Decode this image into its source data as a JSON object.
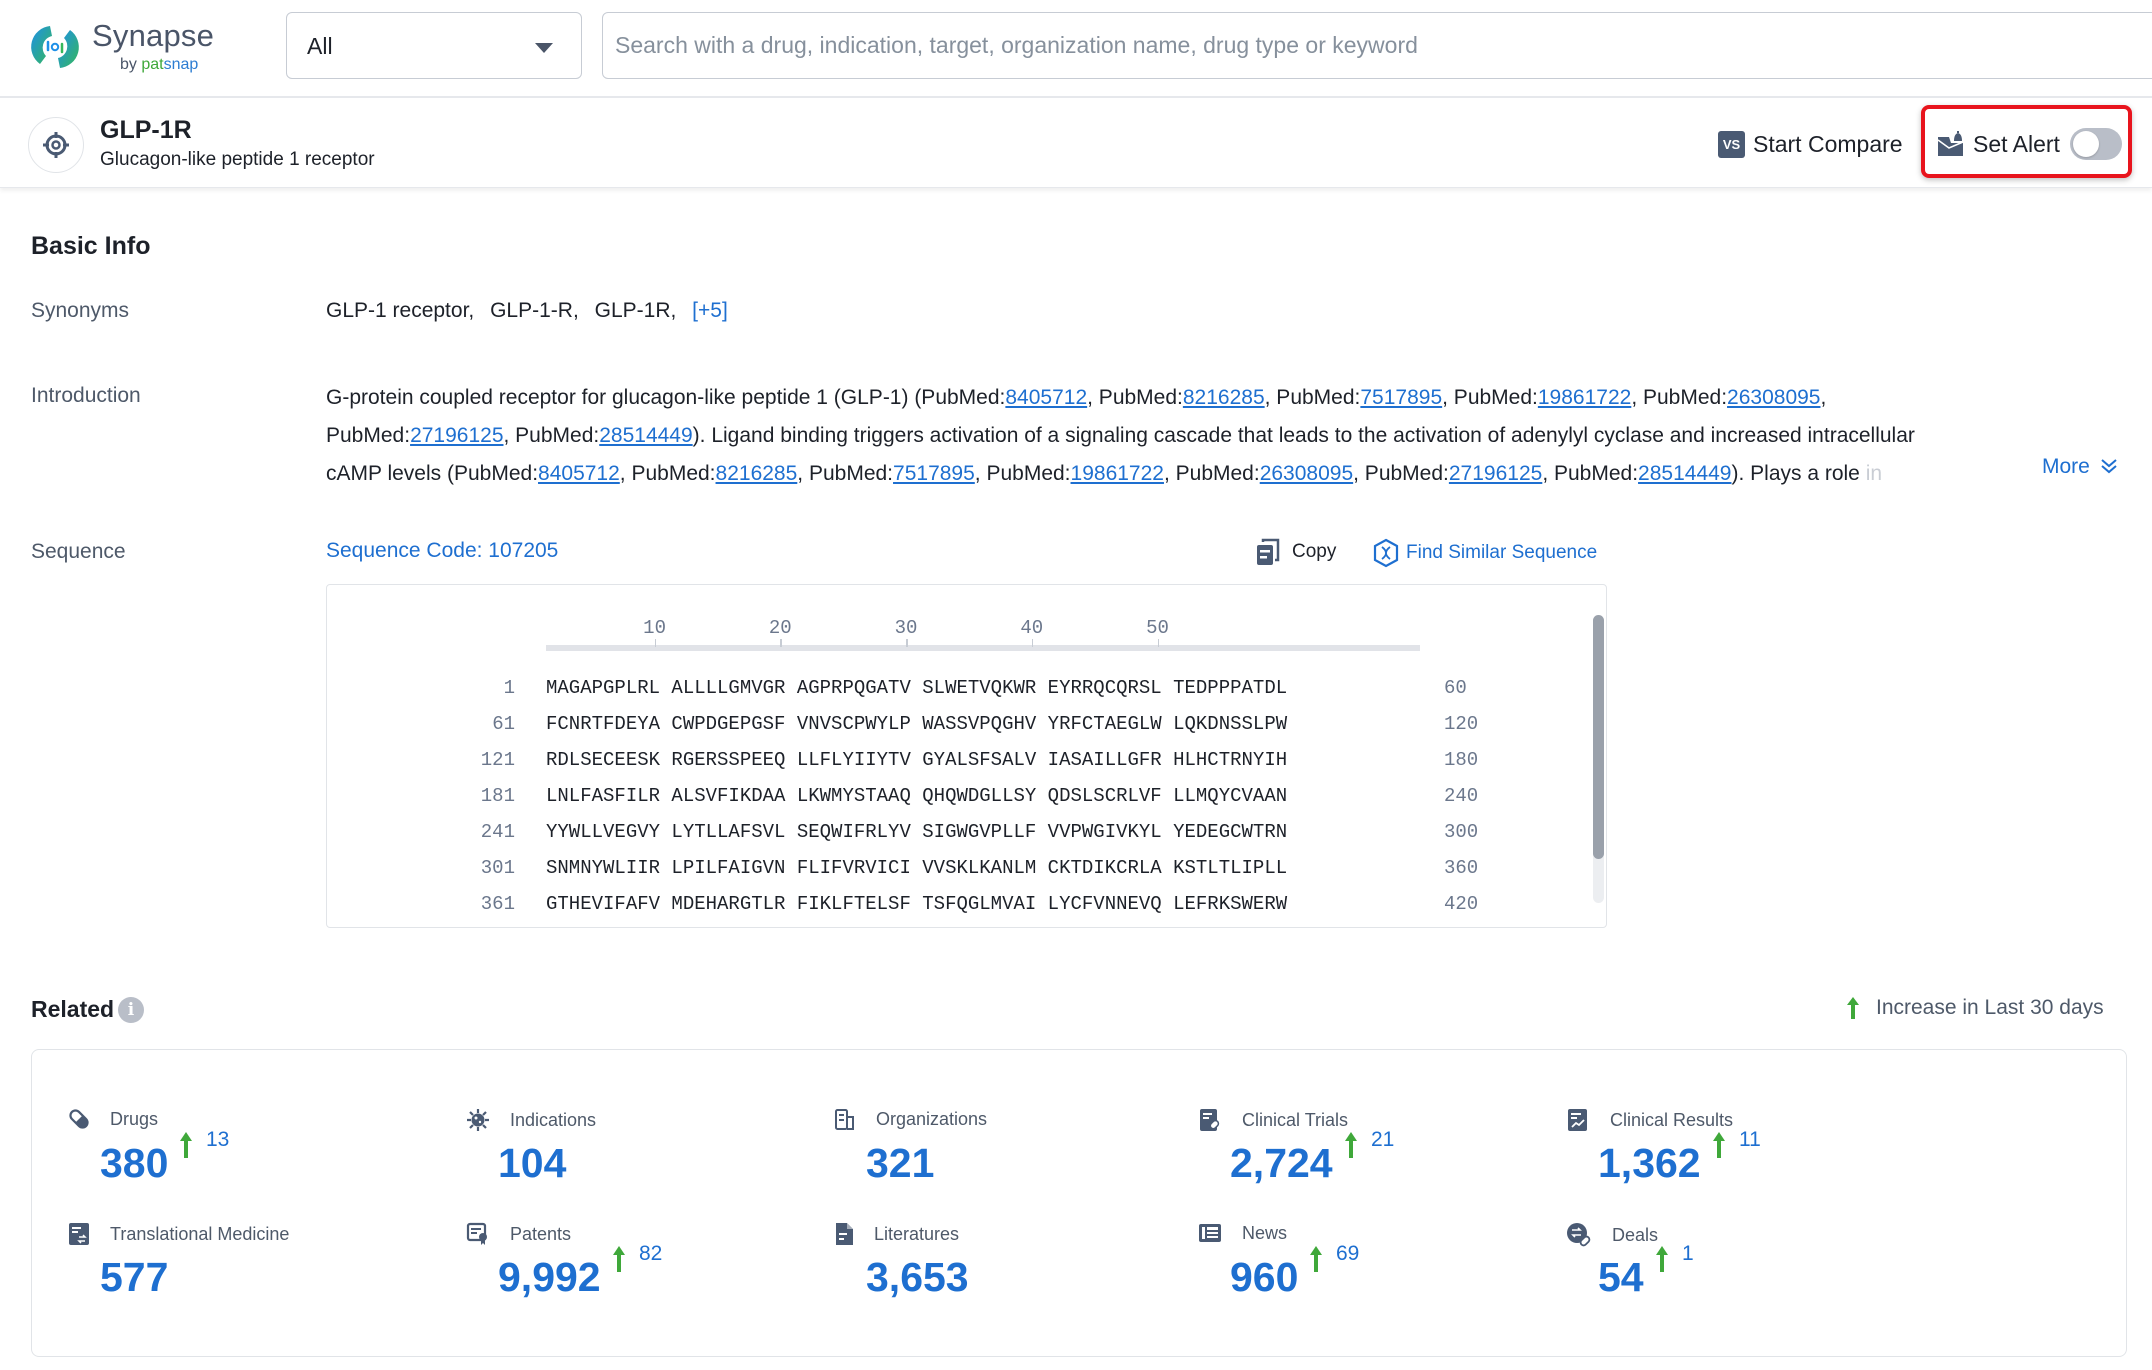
{
  "header": {
    "logo_name": "Synapse",
    "logo_by": "by",
    "logo_pat": "pat",
    "logo_snap": "snap",
    "scope_select_value": "All",
    "search_placeholder": "Search with a drug, indication, target, organization name, drug type or keyword",
    "search_value": ""
  },
  "entity": {
    "icon": "target-icon",
    "title": "GLP-1R",
    "subtitle": "Glucagon-like peptide 1 receptor",
    "compare_icon_text": "VS",
    "compare_label": "Start Compare",
    "alert_label": "Set Alert",
    "alert_enabled": false
  },
  "basic_info": {
    "title": "Basic Info",
    "synonyms_label": "Synonyms",
    "synonyms": [
      "GLP-1 receptor,",
      "GLP-1-R,",
      "GLP-1R,"
    ],
    "synonyms_more": "[+5]",
    "introduction_label": "Introduction",
    "introduction_lines": [
      [
        {
          "t": "G-protein coupled receptor for glucagon-like peptide 1 (GLP-1) (PubMed:"
        },
        {
          "link": "8405712"
        },
        {
          "t": ", PubMed:"
        },
        {
          "link": "8216285"
        },
        {
          "t": ", PubMed:"
        },
        {
          "link": "7517895"
        },
        {
          "t": ", PubMed:"
        },
        {
          "link": "19861722"
        },
        {
          "t": ", PubMed:"
        },
        {
          "link": "26308095"
        },
        {
          "t": ","
        }
      ],
      [
        {
          "t": "PubMed:"
        },
        {
          "link": "27196125"
        },
        {
          "t": ", PubMed:"
        },
        {
          "link": "28514449"
        },
        {
          "t": "). Ligand binding triggers activation of a signaling cascade that leads to the activation of adenylyl cyclase and increased intracellular"
        }
      ],
      [
        {
          "t": "cAMP levels (PubMed:"
        },
        {
          "link": "8405712"
        },
        {
          "t": ", PubMed:"
        },
        {
          "link": "8216285"
        },
        {
          "t": ", PubMed:"
        },
        {
          "link": "7517895"
        },
        {
          "t": ", PubMed:"
        },
        {
          "link": "19861722"
        },
        {
          "t": ", PubMed:"
        },
        {
          "link": "26308095"
        },
        {
          "t": ", PubMed:"
        },
        {
          "link": "27196125"
        },
        {
          "t": ", PubMed:"
        },
        {
          "link": "28514449"
        },
        {
          "t": "). Plays a role "
        },
        {
          "fade": "in"
        }
      ]
    ],
    "more_label": "More",
    "sequence_label": "Sequence",
    "sequence_code": "Sequence Code: 107205",
    "copy_label": "Copy",
    "find_similar_label": "Find Similar Sequence",
    "ruler_ticks": [
      "10",
      "20",
      "30",
      "40",
      "50"
    ],
    "sequence_rows": [
      {
        "start": "1",
        "residues": "MAGAPGPLRL ALLLLGMVGR AGPRPQGATV SLWETVQKWR EYRRQCQRSL TEDPPPATDL",
        "end": "60"
      },
      {
        "start": "61",
        "residues": "FCNRTFDEYA CWPDGEPGSF VNVSCPWYLP WASSVPQGHV YRFCTAEGLW LQKDNSSLPW",
        "end": "120"
      },
      {
        "start": "121",
        "residues": "RDLSECEESK RGERSSPEEQ LLFLYIIYTV GYALSFSALV IASAILLGFR HLHCTRNYIH",
        "end": "180"
      },
      {
        "start": "181",
        "residues": "LNLFASFILR ALSVFIKDAA LKWMYSTAAQ QHQWDGLLSY QDSLSCRLVF LLMQYCVAAN",
        "end": "240"
      },
      {
        "start": "241",
        "residues": "YYWLLVEGVY LYTLLAFSVL SEQWIFRLYV SIGWGVPLLF VVPWGIVKYL YEDEGCWTRN",
        "end": "300"
      },
      {
        "start": "301",
        "residues": "SNMNYWLIIR LPILFAIGVN FLIFVRVICI VVSKLKANLM CKTDIKCRLA KSTLTLIPLL",
        "end": "360"
      },
      {
        "start": "361",
        "residues": "GTHEVIFAFV MDEHARGTLR FIKLFTELSF TSFQGLMVAI LYCFVNNEVQ LEFRKSWERW",
        "end": "420"
      }
    ],
    "sequence_scroll_fraction": 0.0
  },
  "related": {
    "title": "Related",
    "legend_label": "Increase in Last 30 days",
    "stats": [
      {
        "icon": "pill-icon",
        "label": "Drugs",
        "value": "380",
        "increase": "13"
      },
      {
        "icon": "virus-icon",
        "label": "Indications",
        "value": "104",
        "increase": null
      },
      {
        "icon": "building-icon",
        "label": "Organizations",
        "value": "321",
        "increase": null
      },
      {
        "icon": "clinical-trial-icon",
        "label": "Clinical Trials",
        "value": "2,724",
        "increase": "21"
      },
      {
        "icon": "clinical-result-icon",
        "label": "Clinical Results",
        "value": "1,362",
        "increase": "11"
      },
      {
        "icon": "translational-medicine-icon",
        "label": "Translational Medicine",
        "value": "577",
        "increase": null
      },
      {
        "icon": "patent-icon",
        "label": "Patents",
        "value": "9,992",
        "increase": "82"
      },
      {
        "icon": "literature-icon",
        "label": "Literatures",
        "value": "3,653",
        "increase": null
      },
      {
        "icon": "news-icon",
        "label": "News",
        "value": "960",
        "increase": "69"
      },
      {
        "icon": "deals-icon",
        "label": "Deals",
        "value": "54",
        "increase": "1"
      }
    ]
  },
  "colors": {
    "link": "#1e6fd0",
    "increase": "#3fa83a",
    "highlight_border": "#e8141d"
  }
}
